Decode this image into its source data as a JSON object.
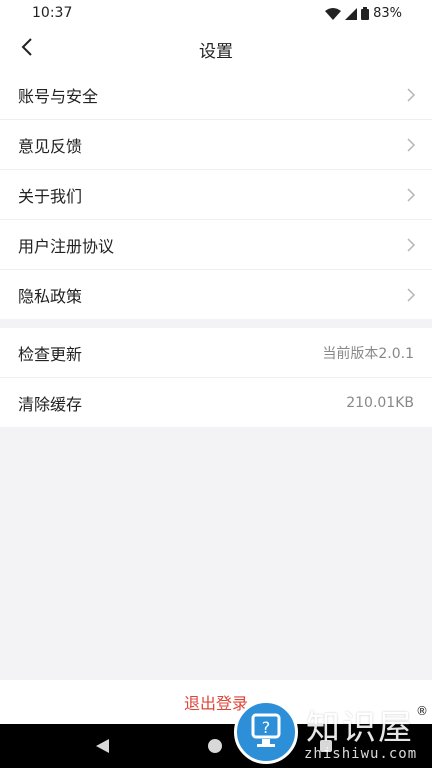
{
  "status_bar": {
    "time": "10:37",
    "battery": "83%"
  },
  "header": {
    "title": "设置",
    "back_icon": "chevron-left-icon"
  },
  "settings_group_1": [
    {
      "label": "账号与安全"
    },
    {
      "label": "意见反馈"
    },
    {
      "label": "关于我们"
    },
    {
      "label": "用户注册协议"
    },
    {
      "label": "隐私政策"
    }
  ],
  "settings_group_2": [
    {
      "label": "检查更新",
      "value": "当前版本2.0.1"
    },
    {
      "label": "清除缓存",
      "value": "210.01KB"
    }
  ],
  "logout": {
    "label": "退出登录",
    "color": "#e0453b"
  },
  "watermark": {
    "title": "知识屋",
    "subtitle": "zhishiwu.com",
    "reg": "®"
  },
  "colors": {
    "accent_red": "#e0453b",
    "background": "#f3f3f5",
    "watermark_blue": "#2d8fd8"
  }
}
